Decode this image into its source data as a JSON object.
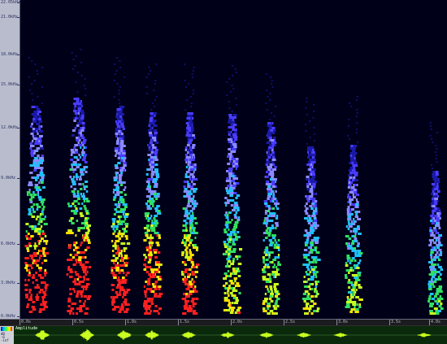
{
  "freq_axis": {
    "labels": [
      "22.05kHz",
      "21.0kHz",
      "18.0kHz",
      "15.0kHz",
      "12.0kHz",
      "9.0kHz",
      "6.0kHz",
      "3.0kHz",
      "0.0kHz"
    ]
  },
  "spectrogram": {
    "palette": [
      "#1a1aa8",
      "#4a3cff",
      "#8a8aff",
      "#20c0ff",
      "#30e060",
      "#c8ff20",
      "#ffe000",
      "#ff2020"
    ],
    "background": "#000018"
  },
  "time_ruler": {
    "labels": [
      "0.0s",
      "0.5s",
      "1.0s",
      "1.5s",
      "2.0s",
      "2.5s",
      "3.0s",
      "3.5s",
      "4.0s"
    ]
  },
  "waveform": {
    "title": "Amplitude",
    "row_labels": [
      "dB",
      "-6",
      "-inf",
      "-6"
    ],
    "color": "#c8ff20",
    "icon": "color-scale-icon"
  }
}
